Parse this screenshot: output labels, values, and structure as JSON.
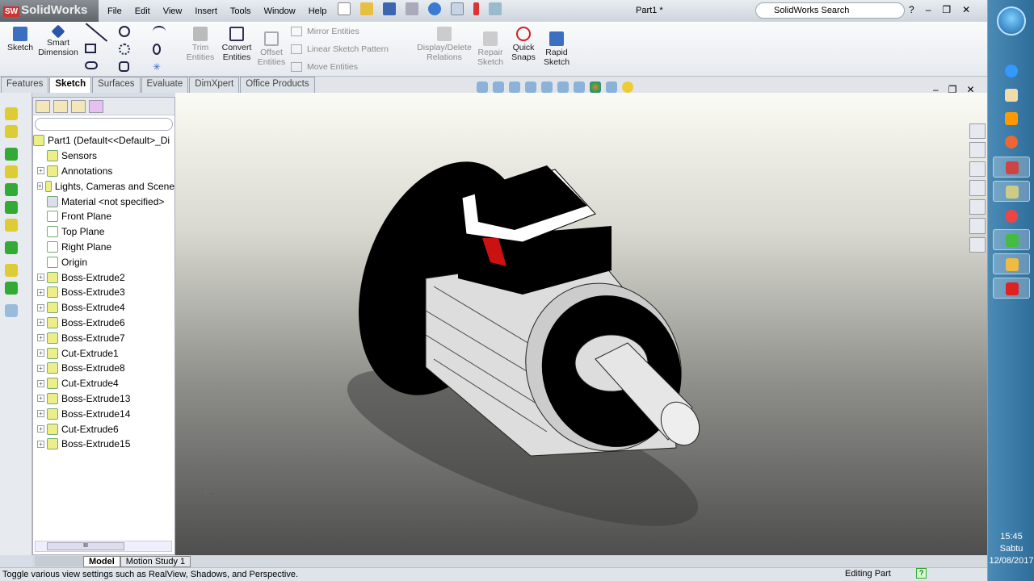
{
  "app": {
    "brand": "SolidWorks",
    "brand_badge": "SW",
    "doc_title": "Part1 *"
  },
  "menu": [
    "File",
    "Edit",
    "View",
    "Insert",
    "Tools",
    "Window",
    "Help"
  ],
  "search": {
    "placeholder": "SolidWorks Search"
  },
  "command_manager": {
    "sketch": "Sketch",
    "smart_dimension": "Smart Dimension",
    "trim": "Trim Entities",
    "convert": "Convert Entities",
    "offset": "Offset Entities",
    "mirror": "Mirror Entities",
    "linear_pattern": "Linear Sketch Pattern",
    "move": "Move Entities",
    "relations": "Display/Delete Relations",
    "repair": "Repair Sketch",
    "quick_snaps": "Quick Snaps",
    "rapid_sketch": "Rapid Sketch"
  },
  "tabs": [
    {
      "label": "Features"
    },
    {
      "label": "Sketch",
      "active": true
    },
    {
      "label": "Surfaces"
    },
    {
      "label": "Evaluate"
    },
    {
      "label": "DimXpert"
    },
    {
      "label": "Office Products"
    }
  ],
  "tree": {
    "root": "Part1  (Default<<Default>_Di",
    "items": [
      {
        "label": "Sensors",
        "expand": false
      },
      {
        "label": "Annotations",
        "expand": true
      },
      {
        "label": "Lights, Cameras and Scene",
        "expand": true
      },
      {
        "label": "Material <not specified>",
        "expand": false
      },
      {
        "label": "Front Plane",
        "expand": false
      },
      {
        "label": "Top Plane",
        "expand": false
      },
      {
        "label": "Right Plane",
        "expand": false
      },
      {
        "label": "Origin",
        "expand": false
      },
      {
        "label": "Boss-Extrude2",
        "expand": true
      },
      {
        "label": "Boss-Extrude3",
        "expand": true
      },
      {
        "label": "Boss-Extrude4",
        "expand": true
      },
      {
        "label": "Boss-Extrude6",
        "expand": true
      },
      {
        "label": "Boss-Extrude7",
        "expand": true
      },
      {
        "label": "Cut-Extrude1",
        "expand": true
      },
      {
        "label": "Boss-Extrude8",
        "expand": true
      },
      {
        "label": "Cut-Extrude4",
        "expand": true
      },
      {
        "label": "Boss-Extrude13",
        "expand": true
      },
      {
        "label": "Boss-Extrude14",
        "expand": true
      },
      {
        "label": "Cut-Extrude6",
        "expand": true
      },
      {
        "label": "Boss-Extrude15",
        "expand": true
      }
    ]
  },
  "bottom_tabs": [
    {
      "label": "Model",
      "active": true
    },
    {
      "label": "Motion Study 1"
    }
  ],
  "status": {
    "message": "Toggle various view settings such as RealView, Shadows, and Perspective.",
    "mode": "Editing Part",
    "help": "?"
  },
  "taskbar": {
    "time": "15:45",
    "day": "Sabtu",
    "date": "12/08/2017"
  },
  "colors": {
    "accent": "#2f6d9a",
    "model_red": "#cc1111"
  }
}
